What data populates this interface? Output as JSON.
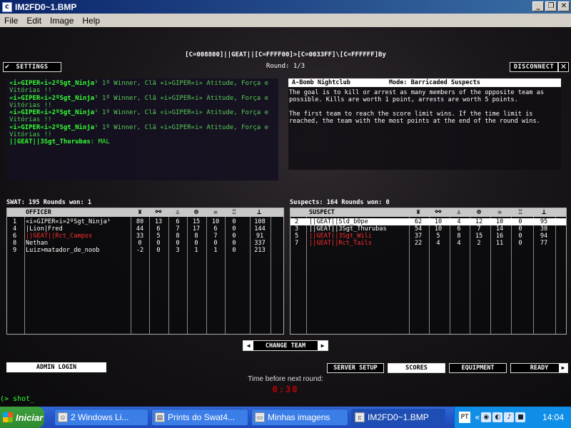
{
  "window": {
    "title": "IM2FD0~1.BMP",
    "minimize": "_",
    "maximize": "❐",
    "close": "✕"
  },
  "menu": [
    "File",
    "Edit",
    "Image",
    "Help"
  ],
  "hud": {
    "server_line": "[C=008800]||GEAT||[C=FFFF00]>[C=0033FF]\\[C=FFFFFF]By",
    "round": "Round: 1/3",
    "settings": "SETTINGS",
    "disconnect": "DISCONNECT",
    "close": "✕"
  },
  "chat": [
    {
      "name": "«i»GIPER«i»2ºSgt_Ninja",
      "msg": "¹ 1º Winner, Clã «i»GIPER«i» Atitude, Força e Vitórias !!"
    },
    {
      "name": "«i»GIPER«i»2ºSgt_Ninja",
      "msg": "¹ 1º Winner, Clã «i»GIPER«i» Atitude, Força e Vitórias !!"
    },
    {
      "name": "«i»GIPER«i»2ºSgt_Ninja",
      "msg": "¹ 1º Winner, Clã «i»GIPER«i» Atitude, Força e Vitórias !!"
    },
    {
      "name": "«i»GIPER«i»2ºSgt_Ninja",
      "msg": "¹ 1º Winner, Clã «i»GIPER«i» Atitude, Força e Vitórias !!"
    },
    {
      "name": "||GEAT||3Sgt_Thurubas",
      "msg": ": MAL"
    }
  ],
  "map": {
    "name": "A-Bomb Nightclub",
    "mode": "Mode: Barricaded Suspects",
    "desc1": "The goal is to kill or arrest as many members of the opposite team as possible.  Kills are worth 1 point, arrests are worth 5 points.",
    "desc2": "The first team to reach the score limit wins.  If the time limit is reached, the team with the most points at the end of the round wins."
  },
  "swat": {
    "summary": "SWAT: 195    Rounds won: 1",
    "header": "OFFICER",
    "rows": [
      {
        "rank": "1",
        "name": "«i»GIPER«i»2ºSgt_Ninja¹",
        "red": false,
        "s": [
          "80",
          "13",
          "6",
          "15",
          "10",
          "0",
          "108"
        ]
      },
      {
        "rank": "4",
        "name": "|Lion|Fred",
        "red": false,
        "s": [
          "44",
          "6",
          "7",
          "17",
          "6",
          "0",
          "144"
        ]
      },
      {
        "rank": "6",
        "name": "||GEAT||Rct_Campos",
        "red": true,
        "s": [
          "33",
          "5",
          "8",
          "8",
          "7",
          "0",
          "91"
        ]
      },
      {
        "rank": "8",
        "name": "Nethan",
        "red": false,
        "s": [
          "0",
          "0",
          "0",
          "0",
          "0",
          "0",
          "337"
        ]
      },
      {
        "rank": "9",
        "name": "Luiz>matador_de_noob",
        "red": false,
        "s": [
          "-2",
          "0",
          "3",
          "1",
          "1",
          "0",
          "213"
        ]
      }
    ]
  },
  "suspects": {
    "summary": "Suspects: 164    Rounds won: 0",
    "header": "SUSPECT",
    "rows": [
      {
        "rank": "2",
        "name": "||GEAT||Sld_b0pe",
        "red": false,
        "hl": true,
        "s": [
          "62",
          "10",
          "4",
          "12",
          "10",
          "0",
          "95"
        ]
      },
      {
        "rank": "3",
        "name": "||GEAT||3Sgt_Thurubas",
        "red": false,
        "s": [
          "54",
          "10",
          "6",
          "7",
          "14",
          "0",
          "38"
        ]
      },
      {
        "rank": "5",
        "name": "||GEAT||3Sgt_Wili",
        "red": true,
        "s": [
          "37",
          "5",
          "8",
          "15",
          "16",
          "0",
          "94"
        ]
      },
      {
        "rank": "7",
        "name": "||GEAT||Rct_Tails",
        "red": true,
        "s": [
          "22",
          "4",
          "4",
          "2",
          "11",
          "0",
          "77"
        ]
      }
    ]
  },
  "stat_icons": [
    "trophy-icon",
    "handcuffs-icon",
    "kneel-icon",
    "crosshair-icon",
    "skull-icon",
    "cup-icon",
    "ping-icon"
  ],
  "buttons": {
    "change_team": "CHANGE TEAM",
    "admin_login": "ADMIN LOGIN",
    "server_setup": "SERVER SETUP",
    "scores": "SCORES",
    "equipment": "EQUIPMENT",
    "ready": "READY"
  },
  "next_round": "Time before next round:",
  "timer": "0:30",
  "console": "(> shot_",
  "taskbar": {
    "start": "Iniciar",
    "tasks": [
      "2 Windows Li...",
      "Prints do Swat4...",
      "Minhas imagens",
      "IM2FD0~1.BMP"
    ],
    "lang": "PT",
    "clock": "14:04"
  }
}
